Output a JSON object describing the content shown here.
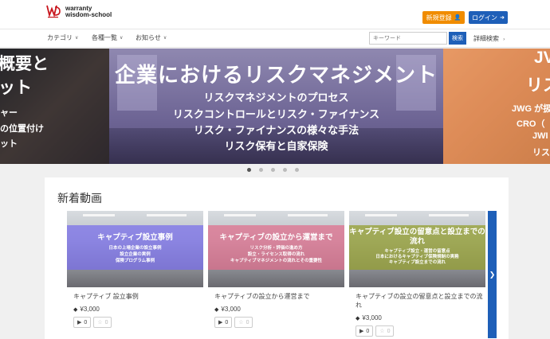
{
  "header": {
    "logo_line1": "warranty",
    "logo_line2": "wisdom-school",
    "register_label": "新規登録",
    "login_label": "ログイン",
    "colors": {
      "register": "#f08c00",
      "login": "#1e5fb8"
    }
  },
  "nav": {
    "items": [
      {
        "label": "カテゴリ"
      },
      {
        "label": "各種一覧"
      },
      {
        "label": "お知らせ"
      }
    ],
    "search_placeholder": "キーワード",
    "search_button": "検索",
    "advanced_search": "詳細検索"
  },
  "banner": {
    "left_lines": [
      "概要と",
      "ット",
      "ャー",
      "の位置付け",
      "ット"
    ],
    "main_title": "企業におけるリスクマネジメント",
    "main_lines": [
      "リスクマネジメントのプロセス",
      "リスクコントロールとリスク・ファイナンス",
      "リスク・ファイナンスの様々な手法",
      "リスク保有と自家保険"
    ],
    "right_lines": [
      "JV",
      "リス",
      "JWG が扱",
      "CRO（",
      "JWI",
      "リス"
    ],
    "dots": 5,
    "active_dot": 0
  },
  "section": {
    "title": "新着動画"
  },
  "cards": [
    {
      "overlay_title": "キャプティブ設立事例",
      "overlay_lines": [
        "日本の上場企業の設立事例",
        "設立企業の実例",
        "保険プログラム事例"
      ],
      "overlay_color": "rgba(120,110,235,0.72)",
      "title": "キャプティブ 設立事例",
      "price": "¥3,000",
      "plays": "0",
      "favs": "0"
    },
    {
      "overlay_title": "キャプティブの設立から運営まで",
      "overlay_lines": [
        "リスク分析・評価の進め方",
        "設立・ライセンス取得の流れ",
        "キャプティブマネジメントの流れとその重要性"
      ],
      "overlay_color": "rgba(225,110,140,0.72)",
      "title": "キャプティブの設立から運営まで",
      "price": "¥3,000",
      "plays": "0",
      "favs": "0"
    },
    {
      "overlay_title": "キャプティブ設立の留意点と設立までの流れ",
      "overlay_lines": [
        "キャプティブ設立・運営の留意点",
        "日本におけるキャプティブ保険規制の実務",
        "キャプティブ設立までの流れ"
      ],
      "overlay_color": "rgba(150,160,50,0.75)",
      "title": "キャプティブの設立の留意点と設立までの流れ",
      "price": "¥3,000",
      "plays": "0",
      "favs": "0"
    }
  ]
}
